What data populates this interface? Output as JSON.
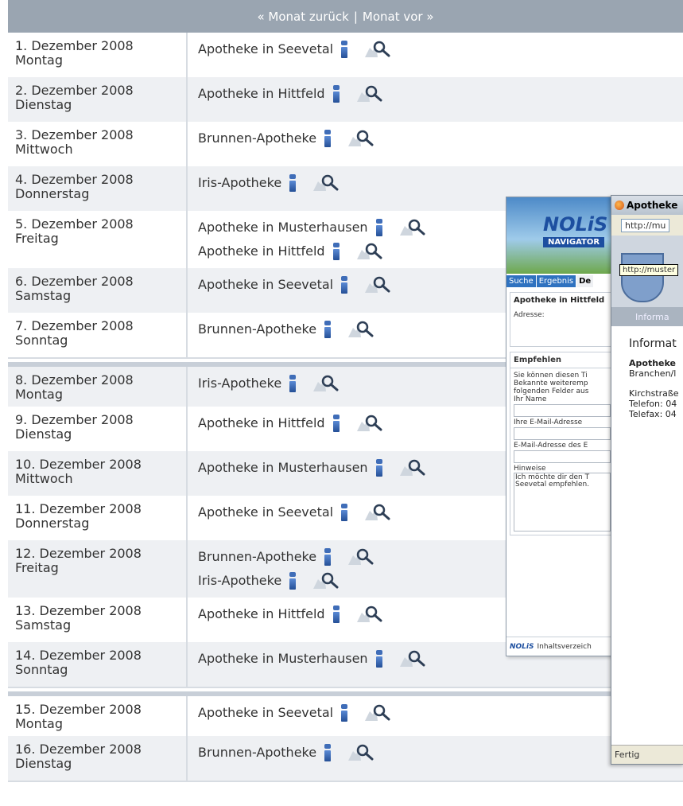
{
  "nav": {
    "prev": "« Monat zurück",
    "separator": "|",
    "next": "Monat vor »"
  },
  "rows": [
    {
      "date": "1. Dezember 2008",
      "weekday": "Montag",
      "pharmacies": [
        "Apotheke in Seevetal"
      ]
    },
    {
      "date": "2. Dezember 2008",
      "weekday": "Dienstag",
      "pharmacies": [
        "Apotheke in Hittfeld"
      ]
    },
    {
      "date": "3. Dezember 2008",
      "weekday": "Mittwoch",
      "pharmacies": [
        "Brunnen-Apotheke"
      ]
    },
    {
      "date": "4. Dezember 2008",
      "weekday": "Donnerstag",
      "pharmacies": [
        "Iris-Apotheke"
      ]
    },
    {
      "date": "5. Dezember 2008",
      "weekday": "Freitag",
      "pharmacies": [
        "Apotheke in Musterhausen",
        "Apotheke in Hittfeld"
      ]
    },
    {
      "date": "6. Dezember 2008",
      "weekday": "Samstag",
      "pharmacies": [
        "Apotheke in Seevetal"
      ]
    },
    {
      "date": "7. Dezember 2008",
      "weekday": "Sonntag",
      "pharmacies": [
        "Brunnen-Apotheke"
      ]
    },
    {
      "date": "8. Dezember 2008",
      "weekday": "Montag",
      "pharmacies": [
        "Iris-Apotheke"
      ]
    },
    {
      "date": "9. Dezember 2008",
      "weekday": "Dienstag",
      "pharmacies": [
        "Apotheke in Hittfeld"
      ]
    },
    {
      "date": "10. Dezember 2008",
      "weekday": "Mittwoch",
      "pharmacies": [
        "Apotheke in Musterhausen"
      ]
    },
    {
      "date": "11. Dezember 2008",
      "weekday": "Donnerstag",
      "pharmacies": [
        "Apotheke in Seevetal"
      ]
    },
    {
      "date": "12. Dezember 2008",
      "weekday": "Freitag",
      "pharmacies": [
        "Brunnen-Apotheke",
        "Iris-Apotheke"
      ]
    },
    {
      "date": "13. Dezember 2008",
      "weekday": "Samstag",
      "pharmacies": [
        "Apotheke in Hittfeld"
      ]
    },
    {
      "date": "14. Dezember 2008",
      "weekday": "Sonntag",
      "pharmacies": [
        "Apotheke in Musterhausen"
      ]
    },
    {
      "date": "15. Dezember 2008",
      "weekday": "Montag",
      "pharmacies": [
        "Apotheke in Seevetal"
      ]
    },
    {
      "date": "16. Dezember 2008",
      "weekday": "Dienstag",
      "pharmacies": [
        "Brunnen-Apotheke"
      ]
    }
  ],
  "popup_navigator": {
    "logo": "NOLiS",
    "badge": "NAVIGATOR",
    "tabs": [
      "Suche",
      "Ergebnis",
      "De"
    ],
    "detail_title": "Apotheke in Hittfeld",
    "address_label": "Adresse:",
    "recommend_tab": "Empfehlen",
    "intro": "Sie können diesen Ti Bekannte weiteremp folgenden Felder aus",
    "name_label": "Ihr Name",
    "email_label": "Ihre E-Mail-Adresse",
    "recipient_label": "E-Mail-Adresse des E",
    "notes_label": "Hinweise",
    "notes_text": "Ich möchte dir den T Seevetal empfehlen.",
    "footer_brand": "NOLiS",
    "footer_link": "Inhaltsverzeich"
  },
  "popup_browser": {
    "title": "Apotheke",
    "url": "http://mu",
    "tooltip": "http://muster",
    "strip": "Informa",
    "heading": "Informat",
    "name": "Apotheke",
    "category": "Branchen/l",
    "street": "Kirchstraße",
    "phone": "Telefon: 04",
    "fax": "Telefax: 04",
    "status": "Fertig"
  }
}
